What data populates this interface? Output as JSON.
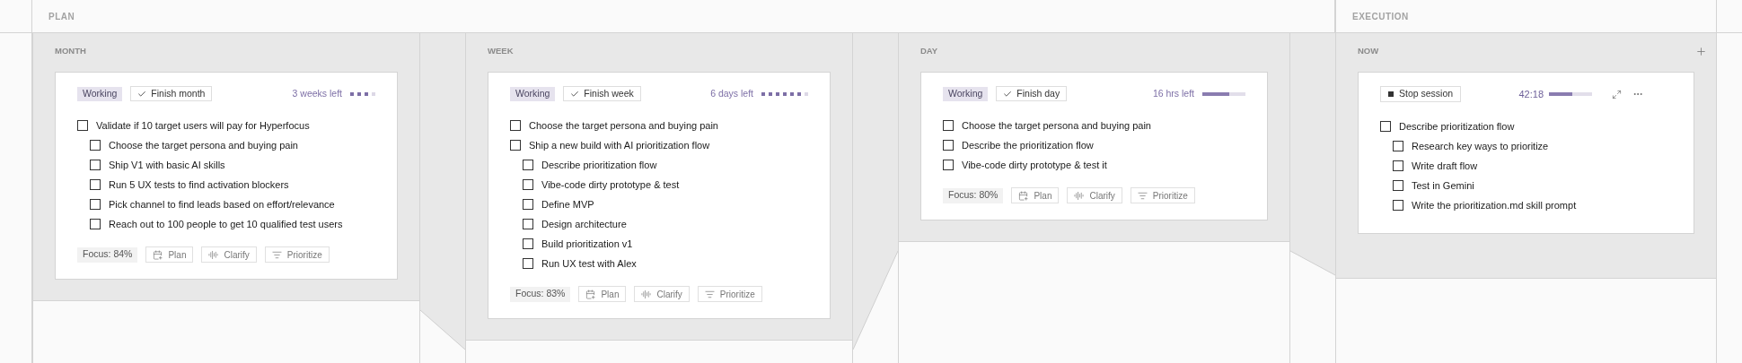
{
  "sections": [
    {
      "title": "PLAN"
    },
    {
      "title": "EXECUTION"
    }
  ],
  "panels": [
    {
      "kind": "plan",
      "title": "MONTH",
      "status": "Working",
      "finish_button": "Finish month",
      "remaining": "3 weeks left",
      "progress": {
        "kind": "dots",
        "dots": [
          {
            "filled": true
          },
          {
            "filled": true
          },
          {
            "filled": true
          },
          {
            "filled": false
          }
        ]
      },
      "tasks": [
        {
          "label": "Validate if 10 target users will pay for Hyperfocus",
          "checked": false,
          "children": [
            {
              "label": "Choose the target persona and buying pain",
              "checked": false
            },
            {
              "label": "Ship V1 with basic AI skills",
              "checked": false
            },
            {
              "label": "Run 5 UX tests to find activation blockers",
              "checked": false
            },
            {
              "label": "Pick channel to find leads based on effort/relevance",
              "checked": false
            },
            {
              "label": "Reach out to 100 people to get 10 qualified test users",
              "checked": false
            }
          ]
        }
      ],
      "focus": "Focus: 84%",
      "actions": [
        {
          "kind": "plan",
          "label": "Plan"
        },
        {
          "kind": "clarify",
          "label": "Clarify"
        },
        {
          "kind": "prioritize",
          "label": "Prioritize"
        }
      ]
    },
    {
      "kind": "plan",
      "title": "WEEK",
      "status": "Working",
      "finish_button": "Finish week",
      "remaining": "6 days left",
      "progress": {
        "kind": "dots",
        "dots": [
          {
            "filled": true
          },
          {
            "filled": true
          },
          {
            "filled": true
          },
          {
            "filled": true
          },
          {
            "filled": true
          },
          {
            "filled": true
          },
          {
            "filled": false
          }
        ]
      },
      "tasks": [
        {
          "label": "Choose the target persona and buying pain",
          "checked": false
        },
        {
          "label": "Ship a new build with AI prioritization flow",
          "checked": false,
          "children": [
            {
              "label": "Describe prioritization flow",
              "checked": false
            },
            {
              "label": "Vibe-code dirty prototype & test",
              "checked": false
            },
            {
              "label": "Define MVP",
              "checked": false
            },
            {
              "label": "Design architecture",
              "checked": false
            },
            {
              "label": "Build prioritization v1",
              "checked": false
            },
            {
              "label": "Run UX test with Alex",
              "checked": false
            }
          ]
        }
      ],
      "focus": "Focus: 83%",
      "actions": [
        {
          "kind": "plan",
          "label": "Plan"
        },
        {
          "kind": "clarify",
          "label": "Clarify"
        },
        {
          "kind": "prioritize",
          "label": "Prioritize"
        }
      ]
    },
    {
      "kind": "plan",
      "title": "DAY",
      "status": "Working",
      "finish_button": "Finish day",
      "remaining": "16 hrs left",
      "progress": {
        "kind": "bar",
        "level": 0.63
      },
      "tasks": [
        {
          "label": "Choose the target persona and buying pain",
          "checked": false
        },
        {
          "label": "Describe the prioritization flow",
          "checked": false
        },
        {
          "label": "Vibe-code dirty prototype & test it",
          "checked": false
        }
      ],
      "focus": "Focus: 80%",
      "actions": [
        {
          "kind": "plan",
          "label": "Plan"
        },
        {
          "kind": "clarify",
          "label": "Clarify"
        },
        {
          "kind": "prioritize",
          "label": "Prioritize"
        }
      ]
    },
    {
      "kind": "session",
      "title": "NOW",
      "stop_button": "Stop session",
      "timer": "42:18",
      "progress": {
        "kind": "bar",
        "level": 0.55
      },
      "tasks": [
        {
          "label": "Describe prioritization flow",
          "checked": false,
          "children": [
            {
              "label": "Research key ways to prioritize",
              "checked": false
            },
            {
              "label": "Write draft flow",
              "checked": false
            },
            {
              "label": "Test in Gemini",
              "checked": false
            },
            {
              "label": "Write the prioritization.md skill prompt",
              "checked": false
            }
          ]
        }
      ]
    }
  ]
}
